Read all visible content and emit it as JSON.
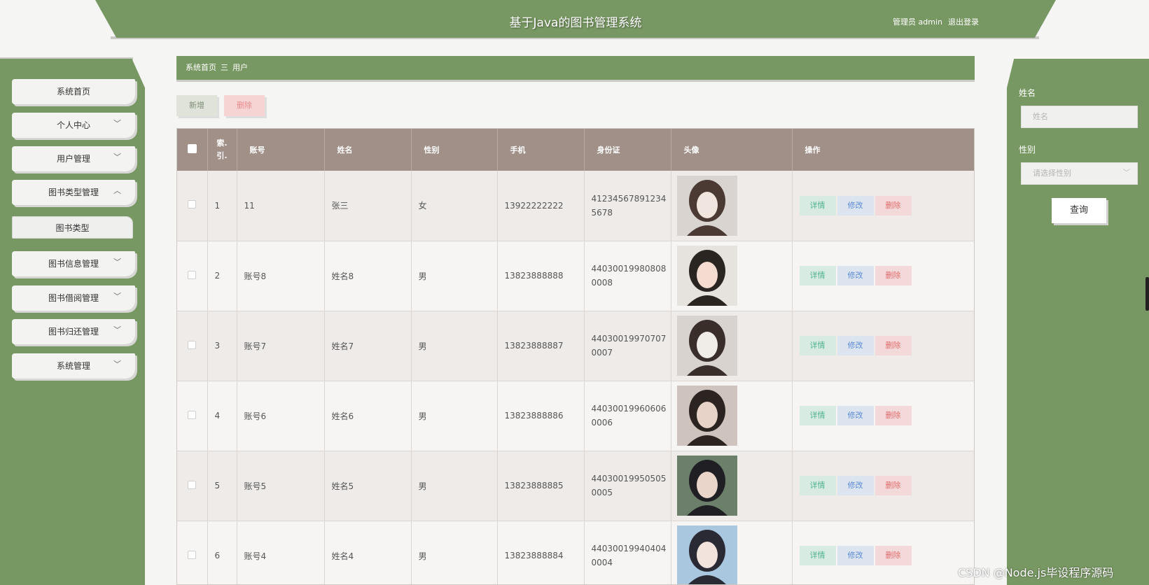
{
  "header": {
    "title": "基于Java的图书管理系统",
    "user_label": "管理员 admin",
    "logout": "退出登录"
  },
  "sidebar": {
    "items": [
      {
        "label": "系统首页"
      },
      {
        "label": "个人中心"
      },
      {
        "label": "用户管理"
      },
      {
        "label": "图书类型管理"
      },
      {
        "label": "图书类型"
      },
      {
        "label": "图书信息管理"
      },
      {
        "label": "图书借阅管理"
      },
      {
        "label": "图书归还管理"
      },
      {
        "label": "系统管理"
      }
    ]
  },
  "breadcrumb": {
    "home": "系统首页",
    "sep": "三",
    "current": "用户"
  },
  "toolbar": {
    "add": "新增",
    "delete": "删除"
  },
  "table": {
    "headers": {
      "index": "索.\n引.",
      "account": "账号",
      "name": "姓名",
      "gender": "性别",
      "phone": "手机",
      "idcard": "身份证",
      "avatar": "头像",
      "actions": "操作"
    },
    "action_labels": {
      "detail": "详情",
      "edit": "修改",
      "delete": "删除"
    },
    "rows": [
      {
        "index": "1",
        "account": "11",
        "name": "张三",
        "gender": "女",
        "phone": "13922222222",
        "idcard": "412345678912345678"
      },
      {
        "index": "2",
        "account": "账号8",
        "name": "姓名8",
        "gender": "男",
        "phone": "13823888888",
        "idcard": "440300199808080008"
      },
      {
        "index": "3",
        "account": "账号7",
        "name": "姓名7",
        "gender": "男",
        "phone": "13823888887",
        "idcard": "440300199707070007"
      },
      {
        "index": "4",
        "account": "账号6",
        "name": "姓名6",
        "gender": "男",
        "phone": "13823888886",
        "idcard": "440300199606060006"
      },
      {
        "index": "5",
        "account": "账号5",
        "name": "姓名5",
        "gender": "男",
        "phone": "13823888885",
        "idcard": "440300199505050005"
      },
      {
        "index": "6",
        "account": "账号4",
        "name": "姓名4",
        "gender": "男",
        "phone": "13823888884",
        "idcard": "440300199404040004"
      }
    ]
  },
  "search": {
    "name_label": "姓名",
    "name_placeholder": "姓名",
    "gender_label": "性别",
    "gender_placeholder": "请选择性别",
    "button": "查询"
  },
  "watermark": "CSDN @Node.js毕设程序源码",
  "colors": {
    "primary": "#789863",
    "table_header": "#a09088"
  }
}
